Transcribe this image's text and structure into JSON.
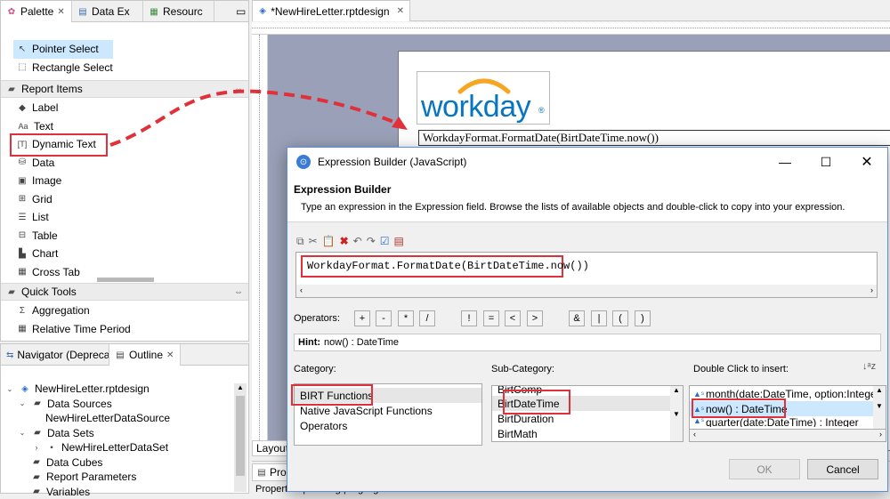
{
  "palette": {
    "tabs": [
      {
        "label": "Palette",
        "icon": "palette-icon"
      },
      {
        "label": "Data Ex",
        "icon": "data-explorer-icon"
      },
      {
        "label": "Resourc",
        "icon": "resource-icon"
      }
    ],
    "tools": [
      "Pointer Select",
      "Rectangle Select"
    ],
    "report_items_header": "Report Items",
    "report_items": [
      "Label",
      "Text",
      "Dynamic Text",
      "Data",
      "Image",
      "Grid",
      "List",
      "Table",
      "Chart",
      "Cross Tab"
    ],
    "quick_tools_header": "Quick Tools",
    "quick_tools": [
      "Aggregation",
      "Relative Time Period"
    ]
  },
  "outline": {
    "tabs": [
      {
        "label": "Navigator (Deprecat"
      },
      {
        "label": "Outline"
      }
    ],
    "tree": [
      {
        "label": "NewHireLetter.rptdesign",
        "level": 0
      },
      {
        "label": "Data Sources",
        "level": 1
      },
      {
        "label": "NewHireLetterDataSource",
        "level": 2
      },
      {
        "label": "Data Sets",
        "level": 1
      },
      {
        "label": "NewHireLetterDataSet",
        "level": 2
      },
      {
        "label": "Data Cubes",
        "level": 1
      },
      {
        "label": "Report Parameters",
        "level": 1
      },
      {
        "label": "Variables",
        "level": 1
      }
    ]
  },
  "editor": {
    "tab_label": "*NewHireLetter.rptdesign",
    "logo_text": "workday",
    "logo_mark": "®",
    "dynamic_text_value": "WorkdayFormat.FormatDate(BirtDateTime.now())",
    "bottom_tab": "Layout"
  },
  "properties_panel": {
    "tab": "Prop",
    "subtabs": "Properties | Binding | Highlights"
  },
  "dialog": {
    "title": "Expression Builder (JavaScript)",
    "heading": "Expression Builder",
    "description": "Type an expression in the Expression field. Browse the lists of available objects and double-click to copy into your expression.",
    "expression": "WorkdayFormat.FormatDate(BirtDateTime.now())",
    "operators_label": "Operators:",
    "operators": [
      "+",
      "-",
      "*",
      "/",
      "!",
      "=",
      "<",
      ">",
      "&",
      "|",
      "(",
      ")"
    ],
    "hint_label": "Hint:",
    "hint_text": "now() : DateTime",
    "category_label": "Category:",
    "categories": [
      "BIRT Functions",
      "Native JavaScript Functions",
      "Operators"
    ],
    "subcategory_label": "Sub-Category:",
    "subcategories": [
      "BirtComp",
      "BirtDateTime",
      "BirtDuration",
      "BirtMath"
    ],
    "insert_label": "Double Click to insert:",
    "insert_items": [
      "month(date:DateTime, option:Integer)",
      "now() : DateTime",
      "quarter(date:DateTime) : Integer"
    ],
    "ok_label": "OK",
    "cancel_label": "Cancel"
  },
  "colors": {
    "highlight_red": "#e0303a",
    "selection_blue": "#cce8ff",
    "workday_blue": "#0875c1",
    "workday_orange": "#f5a623",
    "canvas_gray": "#9aa0b7"
  }
}
